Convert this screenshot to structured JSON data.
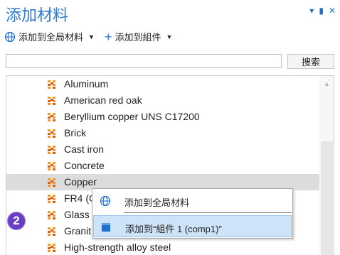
{
  "window": {
    "title": "添加材料",
    "dropdown_icon": "triangle-down-icon",
    "pin_icon": "pin-icon",
    "close_icon": "close-icon",
    "controls": {
      "menu": "▾",
      "pin": "▮",
      "close": "✕"
    }
  },
  "toolbar": {
    "add_global_label": "添加到全局材料",
    "add_global_icon": "globe-icon",
    "add_component_label": "添加到組件",
    "add_component_icon": "plus-icon",
    "caret": "▼",
    "plus": "+"
  },
  "search": {
    "value": "",
    "button_label": "搜索"
  },
  "materials": {
    "items": [
      "Aluminum",
      "American red oak",
      "Beryllium copper UNS C17200",
      "Brick",
      "Cast iron",
      "Concrete",
      "Copper",
      "FR4 (C",
      "Glass",
      "Granit",
      "High-strength alloy steel"
    ],
    "selected_index": 6,
    "icon": "material-grid-icon",
    "icon_colors": [
      "#f29a1f",
      "#e05a1a"
    ]
  },
  "context_menu": {
    "items": [
      {
        "label": "添加到全局材料",
        "icon": "globe-icon"
      },
      {
        "label": "添加到“組件 1 (comp1)”",
        "icon": "component-icon"
      }
    ],
    "highlighted_index": 1
  },
  "step_badge": {
    "label": "2",
    "color": "#6a3fc5"
  },
  "scrollbar": {
    "up_arrow": "▲"
  }
}
